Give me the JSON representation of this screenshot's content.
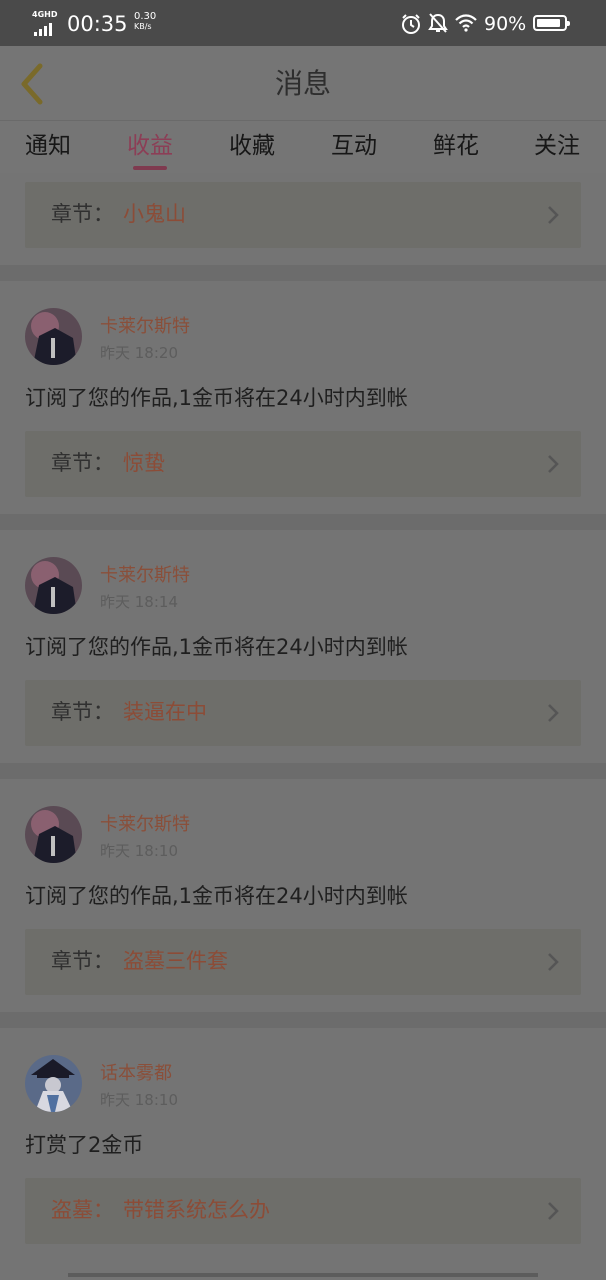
{
  "status_bar": {
    "network": "4GHD",
    "time": "00:35",
    "speed_value": "0.30",
    "speed_unit": "KB/s",
    "battery_pct": "90%",
    "battery_level": 0.9
  },
  "header": {
    "back_icon": "chevron-left-icon",
    "title": "消息"
  },
  "tabs": [
    {
      "label": "通知",
      "active": false
    },
    {
      "label": "收益",
      "active": true
    },
    {
      "label": "收藏",
      "active": false
    },
    {
      "label": "互动",
      "active": false
    },
    {
      "label": "鲜花",
      "active": false
    },
    {
      "label": "关注",
      "active": false
    }
  ],
  "accent_color": "#8c3e56",
  "top_partial": {
    "label": "章节：",
    "chapter": "小鬼山"
  },
  "messages": [
    {
      "author": "卡莱尔斯特",
      "time": "昨天 18:20",
      "text": "订阅了您的作品,1金币将在24小时内到帐",
      "label": "章节：",
      "chapter": "惊蛰"
    },
    {
      "author": "卡莱尔斯特",
      "time": "昨天 18:14",
      "text": "订阅了您的作品,1金币将在24小时内到帐",
      "label": "章节：",
      "chapter": "装逼在中"
    },
    {
      "author": "卡莱尔斯特",
      "time": "昨天 18:10",
      "text": "订阅了您的作品,1金币将在24小时内到帐",
      "label": "章节：",
      "chapter": "盗墓三件套"
    },
    {
      "author": "话本雾都",
      "time": "昨天 18:10",
      "text": "打赏了2金币",
      "label": "盗墓：",
      "chapter": "带错系统怎么办"
    }
  ]
}
